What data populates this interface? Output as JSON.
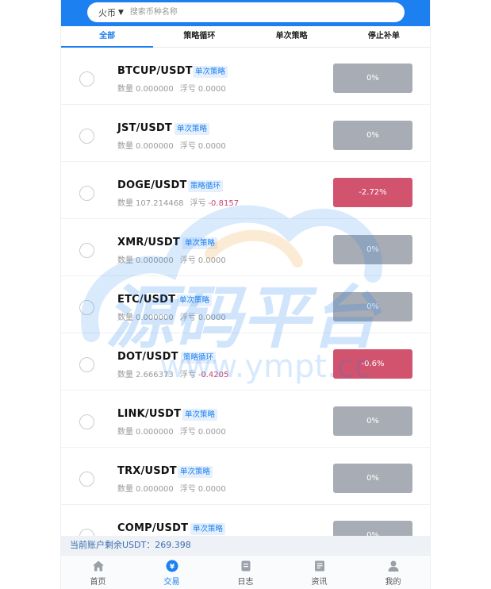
{
  "header": {
    "exchange_label": "火币",
    "exchange_arrow": "▼",
    "search_placeholder": "搜索币种名称"
  },
  "tabs": [
    {
      "label": "全部",
      "active": true
    },
    {
      "label": "策略循环",
      "active": false
    },
    {
      "label": "单次策略",
      "active": false
    },
    {
      "label": "停止补单",
      "active": false
    }
  ],
  "labels": {
    "qty": "数量",
    "pnl": "浮亏"
  },
  "rows": [
    {
      "symbol": "BTCUP/USDT",
      "tag": "单次策略",
      "qty": "0.000000",
      "pnl": "0.0000",
      "pnl_negative": false,
      "button": "0%",
      "button_style": "gray"
    },
    {
      "symbol": "JST/USDT",
      "tag": "单次策略",
      "qty": "0.000000",
      "pnl": "0.0000",
      "pnl_negative": false,
      "button": "0%",
      "button_style": "gray"
    },
    {
      "symbol": "DOGE/USDT",
      "tag": "策略循环",
      "qty": "107.214468",
      "pnl": "-0.8157",
      "pnl_negative": true,
      "button": "-2.72%",
      "button_style": "red"
    },
    {
      "symbol": "XMR/USDT",
      "tag": "单次策略",
      "qty": "0.000000",
      "pnl": "0.0000",
      "pnl_negative": false,
      "button": "0%",
      "button_style": "gray"
    },
    {
      "symbol": "ETC/USDT",
      "tag": "单次策略",
      "qty": "0.000000",
      "pnl": "0.0000",
      "pnl_negative": false,
      "button": "0%",
      "button_style": "gray"
    },
    {
      "symbol": "DOT/USDT",
      "tag": "策略循环",
      "qty": "2.666373",
      "pnl": "-0.4205",
      "pnl_negative": true,
      "button": "-0.6%",
      "button_style": "red"
    },
    {
      "symbol": "LINK/USDT",
      "tag": "单次策略",
      "qty": "0.000000",
      "pnl": "0.0000",
      "pnl_negative": false,
      "button": "0%",
      "button_style": "gray"
    },
    {
      "symbol": "TRX/USDT",
      "tag": "单次策略",
      "qty": "0.000000",
      "pnl": "0.0000",
      "pnl_negative": false,
      "button": "0%",
      "button_style": "gray"
    },
    {
      "symbol": "COMP/USDT",
      "tag": "单次策略",
      "qty": "",
      "pnl": "",
      "pnl_negative": false,
      "button": "0%",
      "button_style": "gray"
    }
  ],
  "balance": "当前账户剩余USDT：269.398",
  "nav": [
    {
      "label": "首页",
      "icon": "home-icon",
      "active": false
    },
    {
      "label": "交易",
      "icon": "trade-icon",
      "active": true
    },
    {
      "label": "日志",
      "icon": "log-icon",
      "active": false
    },
    {
      "label": "资讯",
      "icon": "news-icon",
      "active": false
    },
    {
      "label": "我的",
      "icon": "user-icon",
      "active": false
    }
  ],
  "watermark": {
    "text": "源码平台",
    "url": "www.ympt.cc"
  },
  "colors": {
    "accent": "#1c80f0",
    "button_gray": "#a8acb4",
    "button_red": "#d2536d",
    "negative": "#c9467a"
  }
}
